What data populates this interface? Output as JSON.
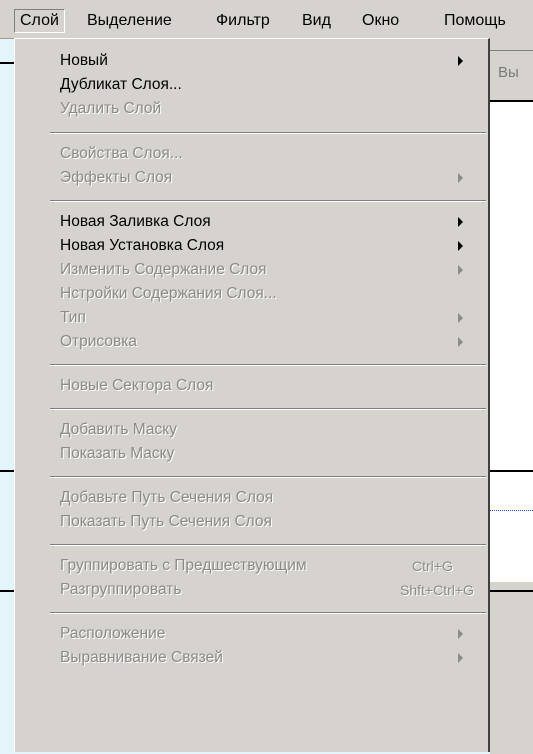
{
  "menubar": {
    "items": [
      "Слой",
      "Выделение",
      "Фильтр",
      "Вид",
      "Окно",
      "Помощь"
    ]
  },
  "background": {
    "field_text": "Вы"
  },
  "menu": {
    "items": [
      {
        "label": "Новый",
        "enabled": true,
        "submenu": true
      },
      {
        "label": "Дубликат Слоя...",
        "enabled": true,
        "submenu": false
      },
      {
        "label": "Удалить Слой",
        "enabled": false,
        "submenu": false
      },
      {
        "label": "Свойства Слоя...",
        "enabled": false,
        "submenu": false
      },
      {
        "label": "Эффекты Слоя",
        "enabled": false,
        "submenu": true
      },
      {
        "label": "Новая Заливка Слоя",
        "enabled": true,
        "submenu": true
      },
      {
        "label": "Новая Установка Слоя",
        "enabled": true,
        "submenu": true
      },
      {
        "label": "Изменить Содержание Слоя",
        "enabled": false,
        "submenu": true
      },
      {
        "label": "Нстройки Содержания Слоя...",
        "enabled": false,
        "submenu": false
      },
      {
        "label": "Тип",
        "enabled": false,
        "submenu": true
      },
      {
        "label": "Отрисовка",
        "enabled": false,
        "submenu": true
      },
      {
        "label": "Новые Сектора Слоя",
        "enabled": false,
        "submenu": false
      },
      {
        "label": "Добавить Маску",
        "enabled": false,
        "submenu": false
      },
      {
        "label": "Показать Маску",
        "enabled": false,
        "submenu": false
      },
      {
        "label": "Добавьте Путь Сечения Слоя",
        "enabled": false,
        "submenu": false
      },
      {
        "label": "Показать Путь Сечения Слоя",
        "enabled": false,
        "submenu": false
      },
      {
        "label": "Группировать с Предшествующим",
        "enabled": false,
        "submenu": false,
        "shortcut": "Ctrl+G"
      },
      {
        "label": "Разгруппировать",
        "enabled": false,
        "submenu": false,
        "shortcut": "Shft+Ctrl+G"
      },
      {
        "label": "Расположение",
        "enabled": false,
        "submenu": true
      },
      {
        "label": "Выравнивание Связей",
        "enabled": false,
        "submenu": true
      }
    ]
  }
}
